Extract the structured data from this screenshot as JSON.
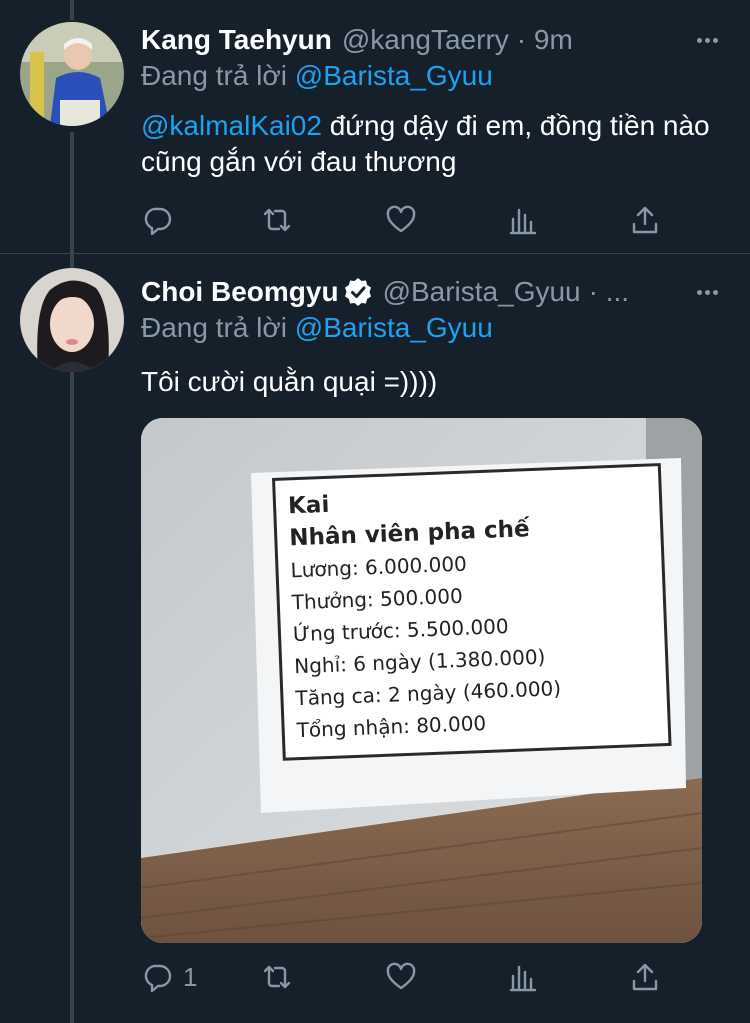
{
  "tweets": [
    {
      "display_name": "Kang Taehyun",
      "handle": "@kangTaerry",
      "time": "· 9m",
      "replying_prefix": "Đang trả lời",
      "replying_to": "@Barista_Gyuu",
      "text_mention": "@kalmalKai02",
      "text": " đứng dậy đi em, đồng tiền nào cũng gắn với đau thương",
      "reply_count": "",
      "avatar_icon": "profile-photo-person-blue-sweater"
    },
    {
      "display_name": "Choi Beomgyu",
      "handle": "@Barista_Gyuu",
      "time": "· ...",
      "verified": true,
      "replying_prefix": "Đang trả lời",
      "replying_to": "@Barista_Gyuu",
      "text": "Tôi cười quằn quại =))))",
      "reply_count": "1",
      "avatar_icon": "profile-photo-person-dark-hair"
    }
  ],
  "media_note": {
    "lines": [
      "Kai",
      "Nhân viên pha chế",
      "Lương: 6.000.000",
      "Thưởng: 500.000",
      "Ứng trước: 5.500.000",
      "Nghỉ: 6 ngày (1.380.000)",
      "Tăng ca: 2 ngày (460.000)",
      "Tổng nhận: 80.000"
    ]
  },
  "action_icons": [
    "reply-icon",
    "retweet-icon",
    "like-icon",
    "analytics-icon",
    "share-icon"
  ],
  "colors": {
    "background": "#15202b",
    "secondary_text": "#8899a6",
    "link": "#1da1f2",
    "divider": "#38444d"
  }
}
